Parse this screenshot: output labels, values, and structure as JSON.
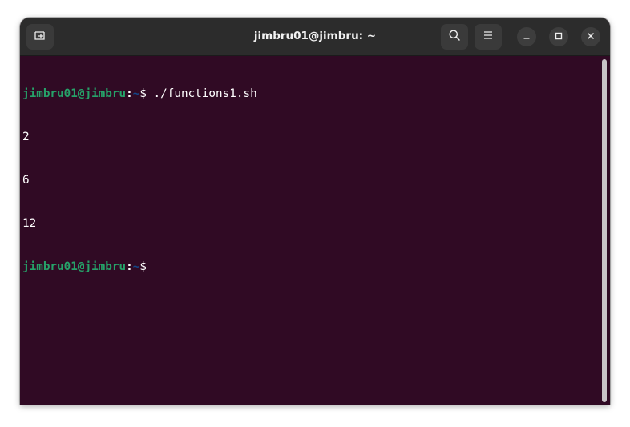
{
  "window": {
    "title": "jimbru01@jimbru: ~"
  },
  "headerbar": {
    "new_tab_icon": "new-tab-icon",
    "search_icon": "search-icon",
    "menu_icon": "hamburger-menu-icon",
    "minimize_icon": "minimize-icon",
    "maximize_icon": "maximize-icon",
    "close_icon": "close-icon"
  },
  "terminal": {
    "colors": {
      "background": "#300a24",
      "prompt_user": "#26a269",
      "prompt_path": "#12488b",
      "text": "#ffffff"
    },
    "lines": [
      {
        "type": "prompt",
        "user_host": "jimbru01@jimbru",
        "colon": ":",
        "path": "~",
        "dollar": "$",
        "command": " ./functions1.sh"
      },
      {
        "type": "output",
        "text": "2"
      },
      {
        "type": "output",
        "text": "6"
      },
      {
        "type": "output",
        "text": "12"
      },
      {
        "type": "prompt",
        "user_host": "jimbru01@jimbru",
        "colon": ":",
        "path": "~",
        "dollar": "$",
        "command": ""
      }
    ]
  }
}
